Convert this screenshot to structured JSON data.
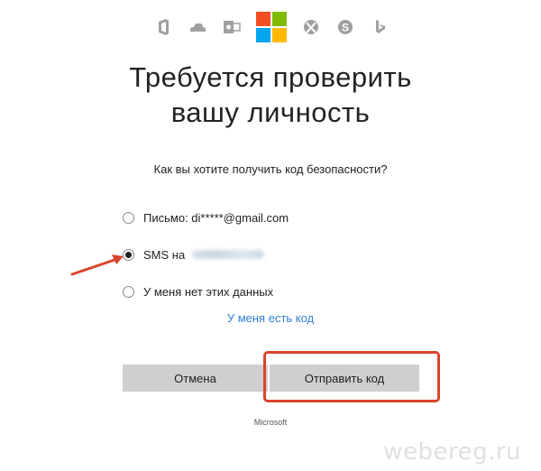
{
  "header": {
    "icons": [
      "office-icon",
      "onedrive-icon",
      "outlook-icon",
      "microsoft-logo",
      "xbox-icon",
      "skype-icon",
      "bing-icon"
    ],
    "ms_colors": [
      "#f25022",
      "#7fba00",
      "#00a4ef",
      "#ffb900"
    ],
    "icon_color": "#a0a0a0"
  },
  "title": {
    "line1": "Требуется проверить",
    "line2": "вашу личность"
  },
  "question": "Как вы хотите получить код безопасности?",
  "options": [
    {
      "label": "Письмо: di*****@gmail.com",
      "selected": false
    },
    {
      "label": "SMS на",
      "selected": true
    },
    {
      "label": "У меня нет этих данных",
      "selected": false
    }
  ],
  "have_code_link": "У меня есть код",
  "buttons": {
    "cancel": "Отмена",
    "send": "Отправить код"
  },
  "footer": "Microsoft",
  "watermark": "webereg.ru",
  "accent_colors": {
    "annotation": "#d9452b",
    "link": "#2f7fd3"
  }
}
